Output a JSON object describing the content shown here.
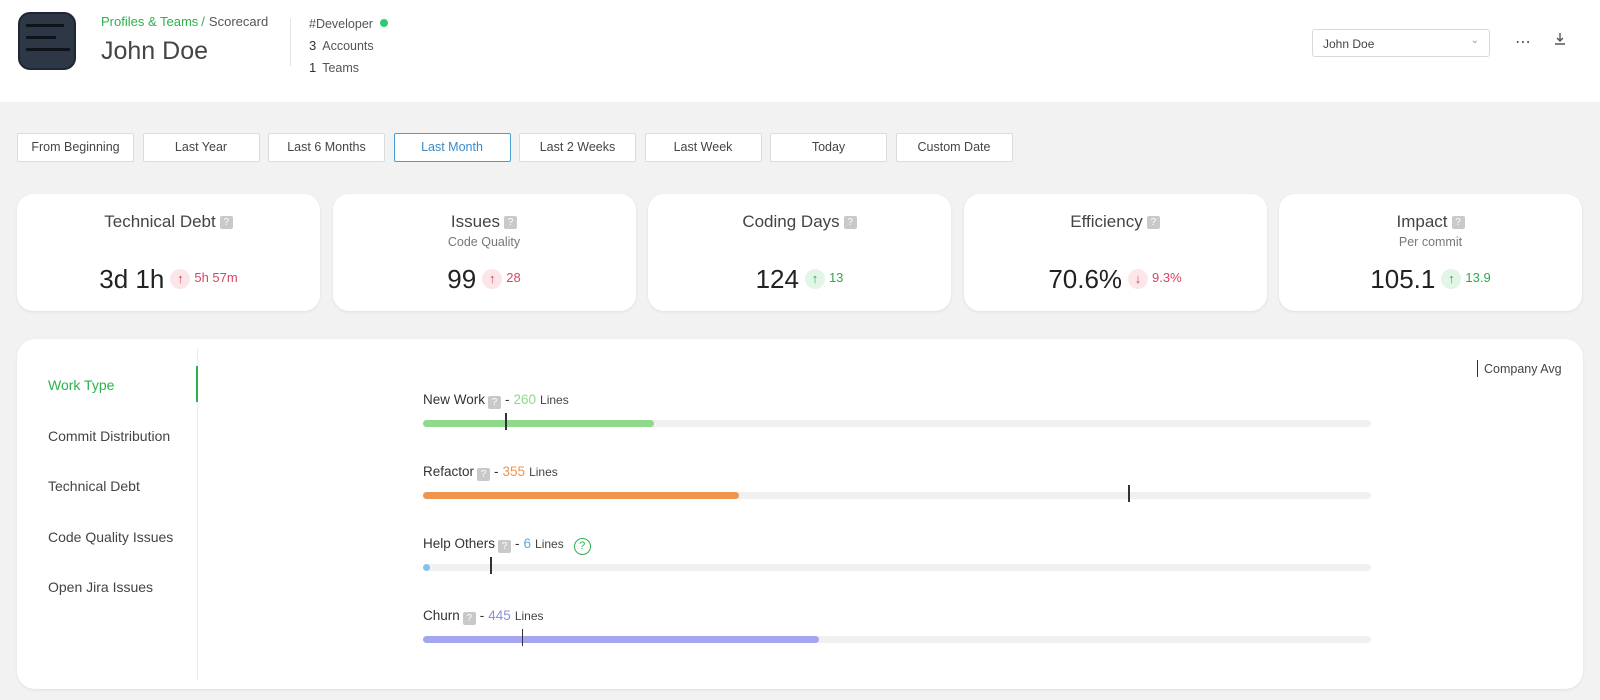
{
  "header": {
    "breadcrumb": {
      "parent": "Profiles & Teams",
      "separator": "/",
      "current": "Scorecard"
    },
    "name": "John Doe",
    "role": "#Developer",
    "accounts": {
      "count": "3",
      "label": "Accounts"
    },
    "teams": {
      "count": "1",
      "label": "Teams"
    },
    "user_select": {
      "value": "John Doe"
    },
    "icons": [
      "more-icon",
      "download-icon"
    ]
  },
  "time_filters": {
    "items": [
      "From Beginning",
      "Last Year",
      "Last 6 Months",
      "Last Month",
      "Last 2 Weeks",
      "Last Week",
      "Today",
      "Custom Date"
    ],
    "active": "Last Month"
  },
  "metrics": [
    {
      "title": "Technical Debt",
      "subtitle": "",
      "value": "3d 1h",
      "delta": "5h 57m",
      "direction": "up",
      "status": "bad"
    },
    {
      "title": "Issues",
      "subtitle": "Code Quality",
      "value": "99",
      "delta": "28",
      "direction": "up",
      "status": "bad"
    },
    {
      "title": "Coding Days",
      "subtitle": "",
      "value": "124",
      "delta": "13",
      "direction": "up",
      "status": "good"
    },
    {
      "title": "Efficiency",
      "subtitle": "",
      "value": "70.6%",
      "delta": "9.3%",
      "direction": "down",
      "status": "bad"
    },
    {
      "title": "Impact",
      "subtitle": "Per commit",
      "value": "105.1",
      "delta": "13.9",
      "direction": "up",
      "status": "good"
    }
  ],
  "sidebar": {
    "items": [
      "Work Type",
      "Commit Distribution",
      "Technical Debt",
      "Code Quality Issues",
      "Open Jira Issues"
    ],
    "active": "Work Type"
  },
  "legend": {
    "label": "Company Avg"
  },
  "work_types": [
    {
      "name": "New Work",
      "separator": "-",
      "lines": "260",
      "unit": "Lines",
      "color": "#8ed98a",
      "value_color": "#8ed98a",
      "fill_fraction": 0.244,
      "avg_fraction": 0.087,
      "help": false
    },
    {
      "name": "Refactor",
      "separator": "-",
      "lines": "355",
      "unit": "Lines",
      "color": "#ef9550",
      "value_color": "#ef9550",
      "fill_fraction": 0.333,
      "avg_fraction": 0.744,
      "help": false
    },
    {
      "name": "Help Others",
      "separator": "-",
      "lines": "6",
      "unit": "Lines",
      "color": "#7fc4ea",
      "value_color": "#5aa8d8",
      "fill_fraction": 0.007,
      "avg_fraction": 0.071,
      "help": true,
      "help_glyph": "?"
    },
    {
      "name": "Churn",
      "separator": "-",
      "lines": "445",
      "unit": "Lines",
      "color": "#a3a5f0",
      "value_color": "#8d90e0",
      "fill_fraction": 0.418,
      "avg_fraction": 0.104,
      "help": false
    }
  ]
}
